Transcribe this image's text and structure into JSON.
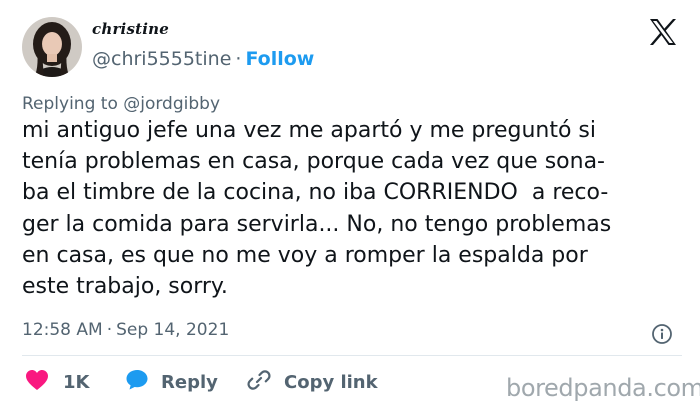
{
  "user": {
    "display_name": "christine",
    "handle": "@chri5555tine",
    "separator": "·",
    "follow_label": "Follow"
  },
  "reply_context": "Replying to @jordgibby",
  "tweet": {
    "lines": [
      "mi antiguo jefe una vez me apartó y me preguntó si",
      "tenía problemas en casa, porque cada vez que sona-",
      "ba el timbre de la cocina, no iba CORRIENDO  a reco-",
      "ger la comida para servirla... No, no tengo problemas",
      "en casa, es que no me voy a romper la espalda por",
      "este trabajo, sorry."
    ]
  },
  "timestamp": {
    "time": "12:58 AM",
    "separator": "·",
    "date": "Sep 14, 2021"
  },
  "actions": {
    "like_count": "1K",
    "reply_label": "Reply",
    "copy_label": "Copy link"
  },
  "watermark": "boredpanda.com",
  "icons": {
    "logo": "x-logo-icon",
    "info": "info-icon",
    "like": "heart-icon",
    "reply": "reply-bubble-icon",
    "copy": "link-icon"
  },
  "colors": {
    "text": "#0f1419",
    "secondary": "#536471",
    "accent": "#1d9bf0",
    "like": "#f91880",
    "divider": "#e1e8ed"
  }
}
